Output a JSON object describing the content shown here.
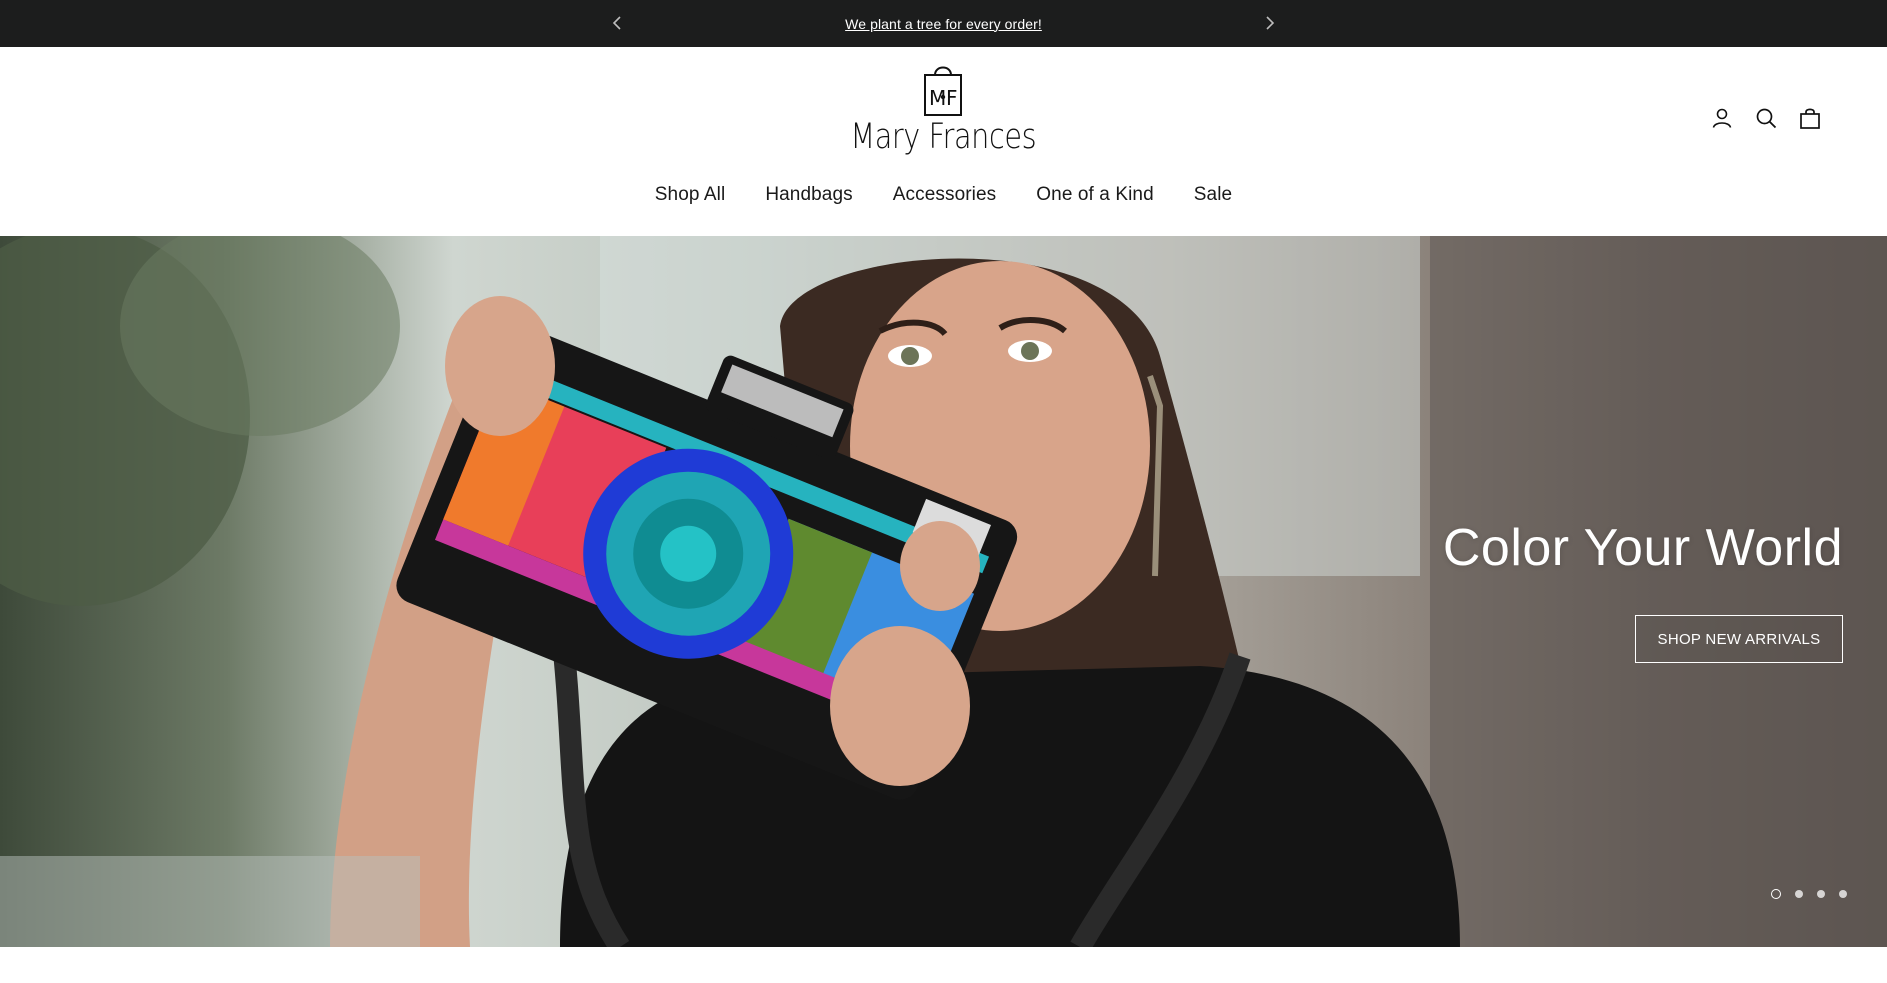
{
  "announcement": {
    "message": "We plant a tree for every order!"
  },
  "header": {
    "logo_monogram": "M F",
    "logo_text": "Mary Frances"
  },
  "nav": {
    "items": [
      {
        "label": "Shop All"
      },
      {
        "label": "Handbags"
      },
      {
        "label": "Accessories"
      },
      {
        "label": "One of a Kind"
      },
      {
        "label": "Sale"
      }
    ]
  },
  "hero": {
    "headline": "Color Your World",
    "cta_label": "SHOP NEW ARRIVALS",
    "slide_count": 4,
    "active_slide": 1
  },
  "icons": {
    "prev": "chevron-left-icon",
    "next": "chevron-right-icon",
    "account": "account-icon",
    "search": "search-icon",
    "cart": "shopping-bag-icon"
  },
  "colors": {
    "announcement_bg": "#1c1d1d",
    "text": "#1a1a1a",
    "hero_text": "#ffffff"
  }
}
